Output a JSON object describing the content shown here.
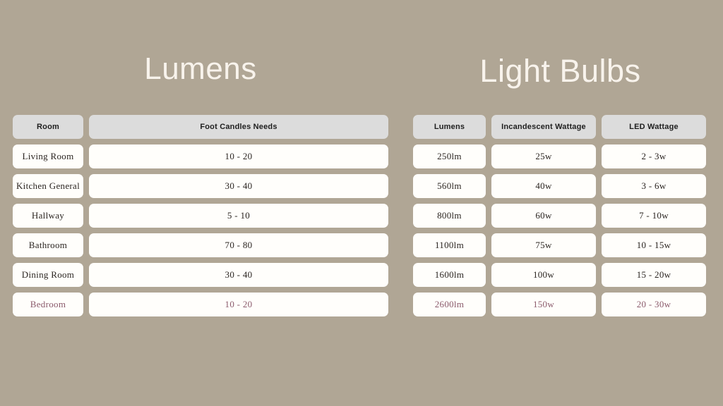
{
  "background_color": "#b0a695",
  "accent_color": "#8b5a6b",
  "card_color": "#fffefb",
  "header_color": "#dcdcdc",
  "title_color": "#f8f3ec",
  "lumens_section": {
    "title": "Lumens",
    "headers": {
      "room": "Room",
      "foot_candles": "Foot Candles Needs"
    },
    "rows": [
      {
        "room": "Living Room",
        "foot_candles": "10 - 20",
        "highlight": false
      },
      {
        "room": "Kitchen General",
        "foot_candles": "30 - 40",
        "highlight": false
      },
      {
        "room": "Hallway",
        "foot_candles": "5 - 10",
        "highlight": false
      },
      {
        "room": "Bathroom",
        "foot_candles": "70 - 80",
        "highlight": false
      },
      {
        "room": "Dining Room",
        "foot_candles": "30 - 40",
        "highlight": false
      },
      {
        "room": "Bedroom",
        "foot_candles": "10 - 20",
        "highlight": true
      }
    ]
  },
  "bulbs_section": {
    "title": "Light Bulbs",
    "headers": {
      "lumens": "Lumens",
      "incandescent": "Incandescent Wattage",
      "led": "LED Wattage"
    },
    "rows": [
      {
        "lumens": "250lm",
        "incandescent": "25w",
        "led": "2 - 3w",
        "highlight": false
      },
      {
        "lumens": "560lm",
        "incandescent": "40w",
        "led": "3 - 6w",
        "highlight": false
      },
      {
        "lumens": "800lm",
        "incandescent": "60w",
        "led": "7 - 10w",
        "highlight": false
      },
      {
        "lumens": "1100lm",
        "incandescent": "75w",
        "led": "10 - 15w",
        "highlight": false
      },
      {
        "lumens": "1600lm",
        "incandescent": "100w",
        "led": "15 - 20w",
        "highlight": false
      },
      {
        "lumens": "2600lm",
        "incandescent": "150w",
        "led": "20 - 30w",
        "highlight": true
      }
    ]
  }
}
